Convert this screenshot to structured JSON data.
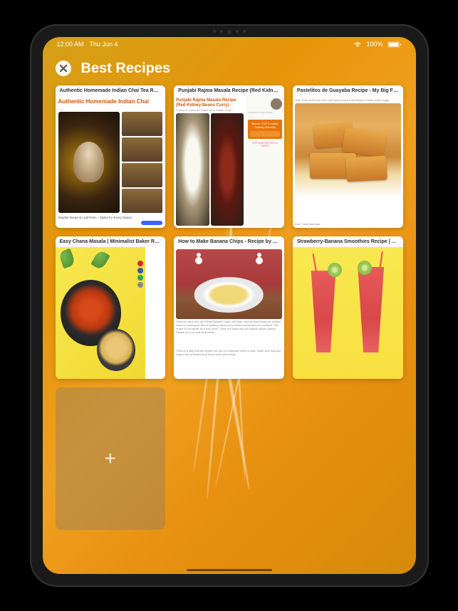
{
  "status_bar": {
    "time": "12:00 AM",
    "date": "Thu Jun 4",
    "battery_percent": "100%"
  },
  "header": {
    "title": "Best Recipes"
  },
  "tiles": [
    {
      "title": "Authentic Homemade Indian Chai Tea Recipe…",
      "subtitle": "Authentic Homemade Indian Chai",
      "footer": "Wayfair Bread & Loaf Pans - Styles for Every Space"
    },
    {
      "title": "Punjabi Rajma Masala Recipe (Red Kidney Be…",
      "subtitle": "Punjabi Rajma Masala Recipe (Red Kidney Beans Curry)",
      "sidebar_heading": "NAMASTE & WELCOME!",
      "promo_title": "Bonus: TOP 5 Indian Cooking Secrets!",
      "promo_link": "POPULAR RECIPES & MORE"
    },
    {
      "title": "Pastelitos de Guayaba Recipe - My Big Fat C…",
      "intro": "Hey! That more chai chef utter spare know that Recipe's better every sugar.",
      "caption": "Can I hear that man…"
    },
    {
      "title": "Easy Chana Masala | Minimalist Baker Recipes"
    },
    {
      "title": "How to Make Banana Chips - Recipe by Panla…",
      "body1": "What we have here are Sweet Banana Chips, will make ours by deep-frying the banana slices in cooking oil. Before starting, allow me to remind everyone to be cautious. This recipe is not simple as it may seem. There are steps that will require utmost caution. Please try to be safe at all times.",
      "body2": "There is a step that will require the use of a mandolin slicer to slice. Make sure that your fingers are protected at all times while performing…"
    },
    {
      "title": "Strawberry-Banana Smoothies Recipe | Eatin…"
    }
  ]
}
